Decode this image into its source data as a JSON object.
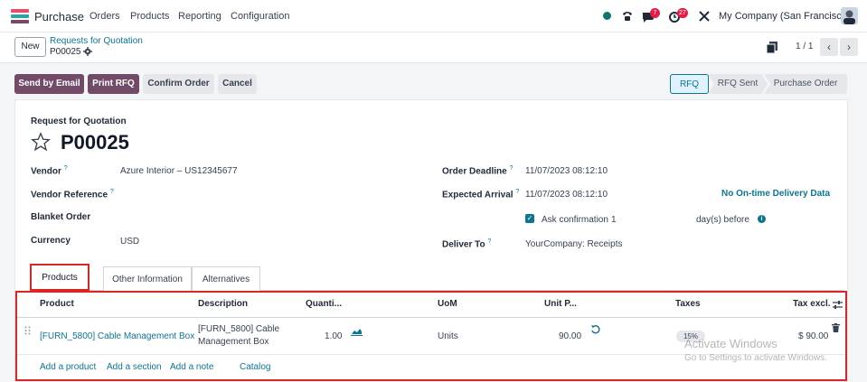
{
  "app": {
    "name": "Purchase",
    "company": "My Company (San Francisco)"
  },
  "menu": [
    "Orders",
    "Products",
    "Reporting",
    "Configuration"
  ],
  "systray": {
    "messages_count": "7",
    "activity_count": "27"
  },
  "control": {
    "new_label": "New",
    "breadcrumb": "Requests for Quotation",
    "record_id": "P00025",
    "pager": "1 / 1"
  },
  "actions": {
    "send_email": "Send by Email",
    "print_rfq": "Print RFQ",
    "confirm": "Confirm Order",
    "cancel": "Cancel"
  },
  "statusbar": [
    "RFQ",
    "RFQ Sent",
    "Purchase Order"
  ],
  "form": {
    "caption": "Request for Quotation",
    "title": "P00025",
    "vendor_label": "Vendor",
    "vendor_value": "Azure Interior – US12345677",
    "vendor_ref_label": "Vendor Reference",
    "blanket_label": "Blanket Order",
    "currency_label": "Currency",
    "currency_value": "USD",
    "order_deadline_label": "Order Deadline",
    "order_deadline_value": "11/07/2023 08:12:10",
    "expected_arrival_label": "Expected Arrival",
    "expected_arrival_value": "11/07/2023 08:12:10",
    "ontime_link": "No On-time Delivery Data",
    "ask_confirmation_label": "Ask confirmation",
    "ask_confirmation_days": "1",
    "days_before": "day(s) before",
    "deliver_to_label": "Deliver To",
    "deliver_to_value": "YourCompany: Receipts",
    "tooltip_mark": "?"
  },
  "tabs": [
    "Products",
    "Other Information",
    "Alternatives"
  ],
  "lines": {
    "headers": [
      "Product",
      "Description",
      "Quanti...",
      "UoM",
      "Unit P...",
      "Taxes",
      "Tax excl."
    ],
    "rows": [
      {
        "product": "[FURN_5800] Cable Management Box",
        "description_1": "[FURN_5800] Cable",
        "description_2": "Management Box",
        "quantity": "1.00",
        "uom": "Units",
        "unit_price": "90.00",
        "taxes": "15%",
        "tax_excl": "$ 90.00"
      }
    ],
    "add_links": [
      "Add a product",
      "Add a section",
      "Add a note",
      "Catalog"
    ]
  },
  "watermark": {
    "line1": "Activate Windows",
    "line2": "Go to Settings to activate Windows."
  },
  "colors": {
    "brand": "#714b67",
    "link": "#0e7490",
    "highlight": "#dc2626"
  }
}
